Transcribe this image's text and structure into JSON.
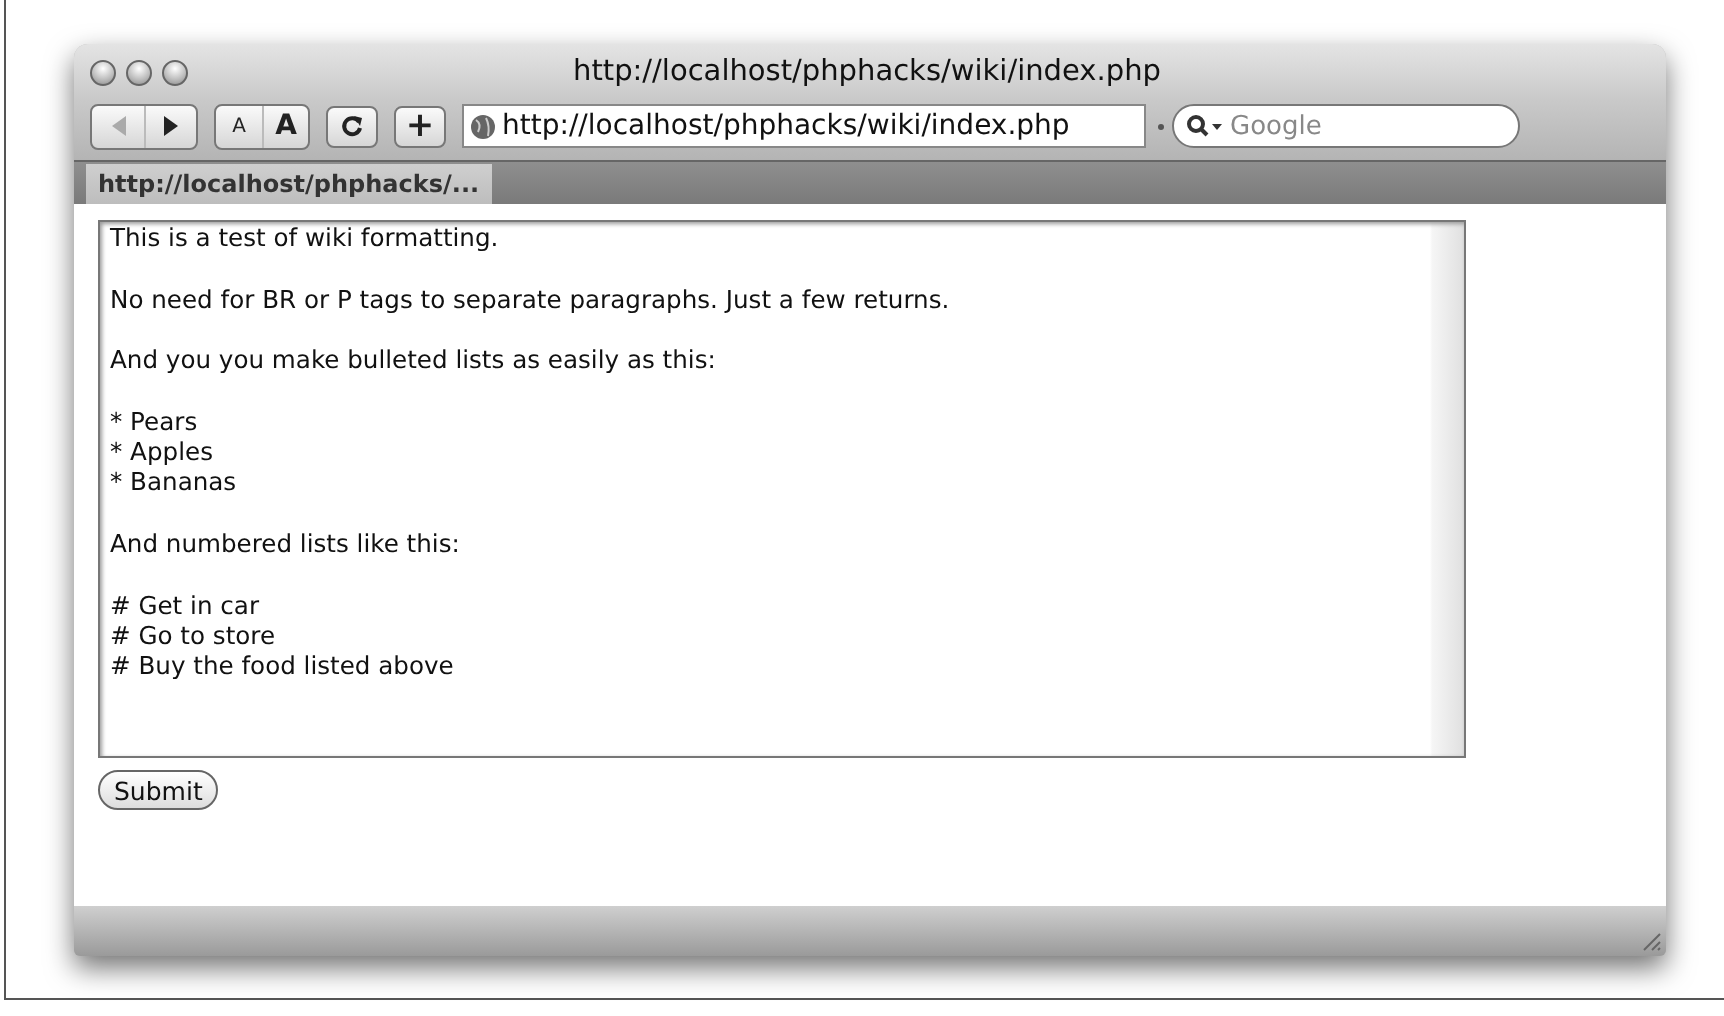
{
  "window": {
    "title": "http://localhost/phphacks/wiki/index.php"
  },
  "toolbar": {
    "nav": [
      {
        "kind": "back",
        "disabled": true
      },
      {
        "kind": "forward",
        "disabled": false
      }
    ],
    "text_smaller": "A",
    "text_bigger": "A",
    "add": "+",
    "address": "http://localhost/phphacks/wiki/index.php",
    "search": {
      "placeholder": "Google"
    }
  },
  "tabs": [
    {
      "label": "http://localhost/phphacks/...",
      "selected": true
    }
  ],
  "form": {
    "paragraphs": [
      [
        "This is a test of wiki formatting."
      ],
      [
        "No need for BR or P tags to separate paragraphs. Just a few returns."
      ],
      [
        "And you you make bulleted lists as easily as this:"
      ],
      [
        "* Pears",
        "* Apples",
        "* Bananas"
      ],
      [
        "And numbered lists like this:"
      ],
      [
        "# Get in car",
        "# Go to store",
        "# Buy the food listed above"
      ]
    ],
    "submit": "Submit"
  }
}
